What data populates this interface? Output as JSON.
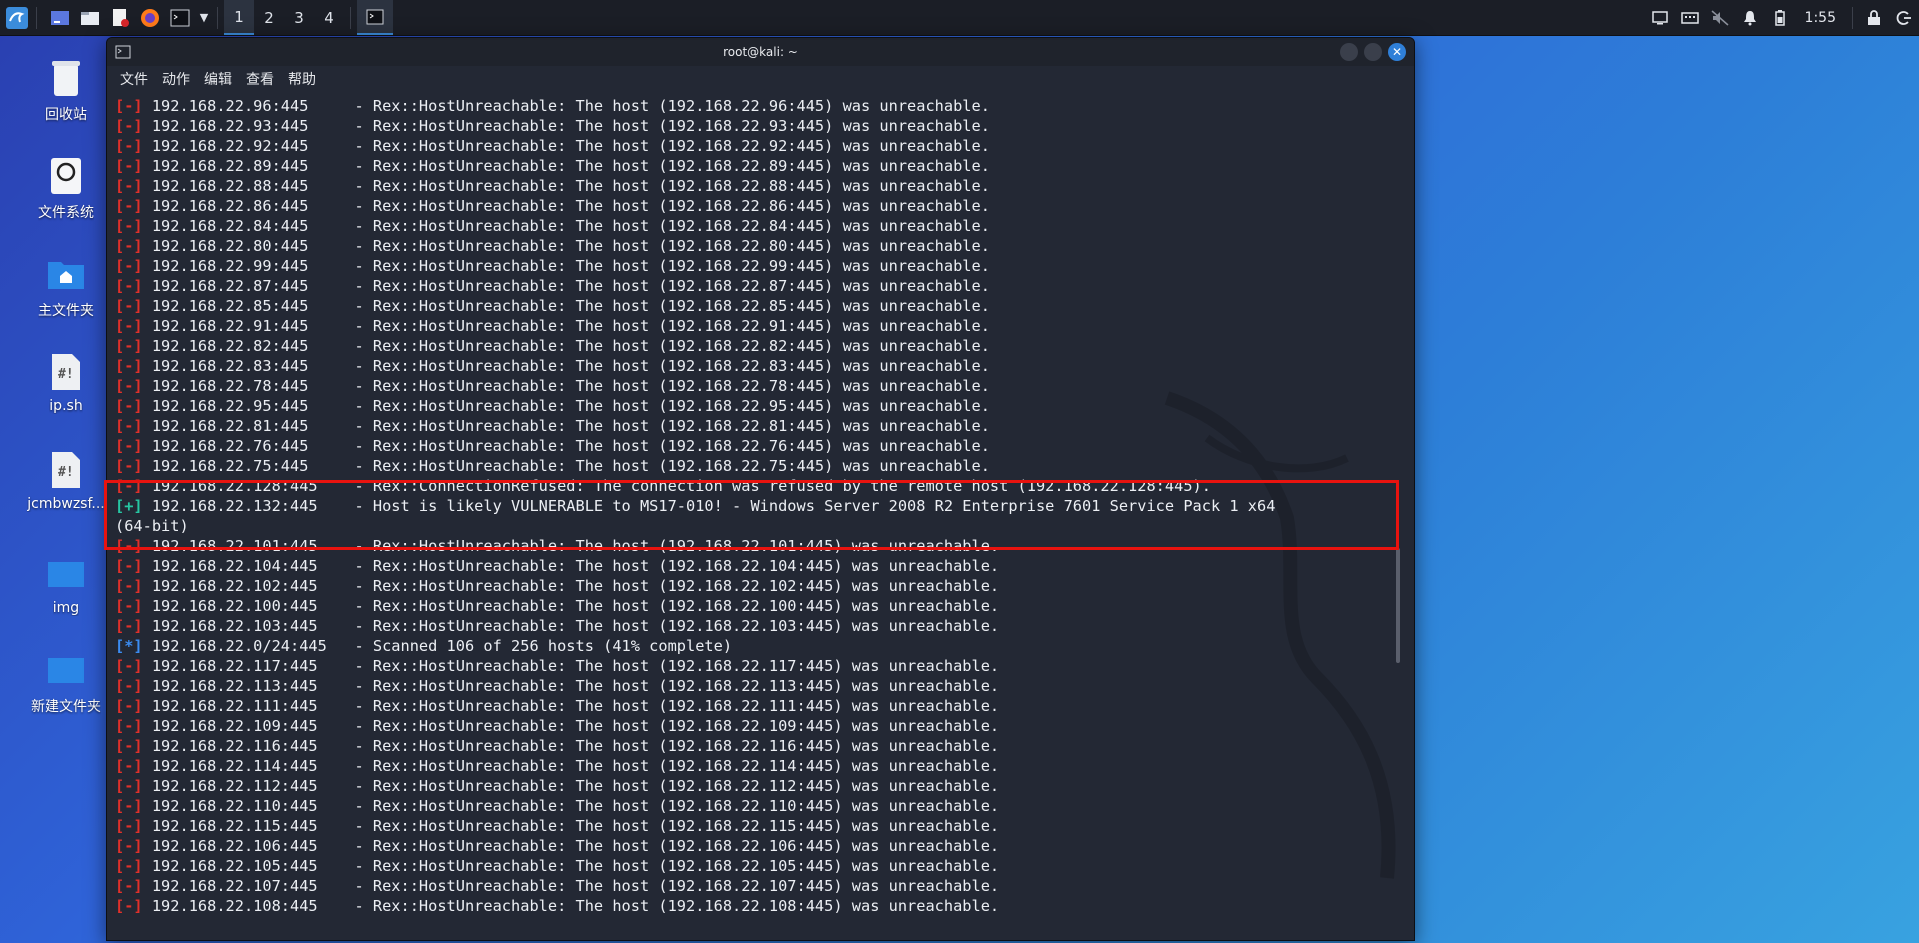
{
  "taskbar": {
    "workspaces": [
      "1",
      "2",
      "3",
      "4"
    ],
    "clock": "1:55"
  },
  "desktop": {
    "icons": [
      {
        "label": "回收站",
        "icon": "trash-icon"
      },
      {
        "label": "文件系统",
        "icon": "drive-icon"
      },
      {
        "label": "主文件夹",
        "icon": "home-folder-icon"
      },
      {
        "label": "ip.sh",
        "icon": "script-icon"
      },
      {
        "label": "jcmbwzsf...",
        "icon": "script-icon"
      },
      {
        "label": "img",
        "icon": "folder-icon"
      },
      {
        "label": "新建文件夹",
        "icon": "folder-icon"
      }
    ]
  },
  "window": {
    "title": "root@kali: ~",
    "menu": [
      "文件",
      "动作",
      "编辑",
      "查看",
      "帮助"
    ]
  },
  "terminal": {
    "lines": [
      {
        "tag": "[-]",
        "kind": "minus",
        "text": " 192.168.22.96:445     - Rex::HostUnreachable: The host (192.168.22.96:445) was unreachable."
      },
      {
        "tag": "[-]",
        "kind": "minus",
        "text": " 192.168.22.93:445     - Rex::HostUnreachable: The host (192.168.22.93:445) was unreachable."
      },
      {
        "tag": "[-]",
        "kind": "minus",
        "text": " 192.168.22.92:445     - Rex::HostUnreachable: The host (192.168.22.92:445) was unreachable."
      },
      {
        "tag": "[-]",
        "kind": "minus",
        "text": " 192.168.22.89:445     - Rex::HostUnreachable: The host (192.168.22.89:445) was unreachable."
      },
      {
        "tag": "[-]",
        "kind": "minus",
        "text": " 192.168.22.88:445     - Rex::HostUnreachable: The host (192.168.22.88:445) was unreachable."
      },
      {
        "tag": "[-]",
        "kind": "minus",
        "text": " 192.168.22.86:445     - Rex::HostUnreachable: The host (192.168.22.86:445) was unreachable."
      },
      {
        "tag": "[-]",
        "kind": "minus",
        "text": " 192.168.22.84:445     - Rex::HostUnreachable: The host (192.168.22.84:445) was unreachable."
      },
      {
        "tag": "[-]",
        "kind": "minus",
        "text": " 192.168.22.80:445     - Rex::HostUnreachable: The host (192.168.22.80:445) was unreachable."
      },
      {
        "tag": "[-]",
        "kind": "minus",
        "text": " 192.168.22.99:445     - Rex::HostUnreachable: The host (192.168.22.99:445) was unreachable."
      },
      {
        "tag": "[-]",
        "kind": "minus",
        "text": " 192.168.22.87:445     - Rex::HostUnreachable: The host (192.168.22.87:445) was unreachable."
      },
      {
        "tag": "[-]",
        "kind": "minus",
        "text": " 192.168.22.85:445     - Rex::HostUnreachable: The host (192.168.22.85:445) was unreachable."
      },
      {
        "tag": "[-]",
        "kind": "minus",
        "text": " 192.168.22.91:445     - Rex::HostUnreachable: The host (192.168.22.91:445) was unreachable."
      },
      {
        "tag": "[-]",
        "kind": "minus",
        "text": " 192.168.22.82:445     - Rex::HostUnreachable: The host (192.168.22.82:445) was unreachable."
      },
      {
        "tag": "[-]",
        "kind": "minus",
        "text": " 192.168.22.83:445     - Rex::HostUnreachable: The host (192.168.22.83:445) was unreachable."
      },
      {
        "tag": "[-]",
        "kind": "minus",
        "text": " 192.168.22.78:445     - Rex::HostUnreachable: The host (192.168.22.78:445) was unreachable."
      },
      {
        "tag": "[-]",
        "kind": "minus",
        "text": " 192.168.22.95:445     - Rex::HostUnreachable: The host (192.168.22.95:445) was unreachable."
      },
      {
        "tag": "[-]",
        "kind": "minus",
        "text": " 192.168.22.81:445     - Rex::HostUnreachable: The host (192.168.22.81:445) was unreachable."
      },
      {
        "tag": "[-]",
        "kind": "minus",
        "text": " 192.168.22.76:445     - Rex::HostUnreachable: The host (192.168.22.76:445) was unreachable."
      },
      {
        "tag": "[-]",
        "kind": "minus",
        "text": " 192.168.22.75:445     - Rex::HostUnreachable: The host (192.168.22.75:445) was unreachable."
      },
      {
        "tag": "[-]",
        "kind": "minus",
        "text": " 192.168.22.128:445    - Rex::ConnectionRefused: The connection was refused by the remote host (192.168.22.128:445)."
      },
      {
        "tag": "[+]",
        "kind": "plus",
        "text": " 192.168.22.132:445    - Host is likely VULNERABLE to MS17-010! - Windows Server 2008 R2 Enterprise 7601 Service Pack 1 x64"
      },
      {
        "tag": "",
        "kind": "plain",
        "text": "(64-bit)"
      },
      {
        "tag": "[-]",
        "kind": "minus",
        "text": " 192.168.22.101:445    - Rex::HostUnreachable: The host (192.168.22.101:445) was unreachable."
      },
      {
        "tag": "[-]",
        "kind": "minus",
        "text": " 192.168.22.104:445    - Rex::HostUnreachable: The host (192.168.22.104:445) was unreachable."
      },
      {
        "tag": "[-]",
        "kind": "minus",
        "text": " 192.168.22.102:445    - Rex::HostUnreachable: The host (192.168.22.102:445) was unreachable."
      },
      {
        "tag": "[-]",
        "kind": "minus",
        "text": " 192.168.22.100:445    - Rex::HostUnreachable: The host (192.168.22.100:445) was unreachable."
      },
      {
        "tag": "[-]",
        "kind": "minus",
        "text": " 192.168.22.103:445    - Rex::HostUnreachable: The host (192.168.22.103:445) was unreachable."
      },
      {
        "tag": "[*]",
        "kind": "star",
        "text": " 192.168.22.0/24:445   - Scanned 106 of 256 hosts (41% complete)"
      },
      {
        "tag": "[-]",
        "kind": "minus",
        "text": " 192.168.22.117:445    - Rex::HostUnreachable: The host (192.168.22.117:445) was unreachable."
      },
      {
        "tag": "[-]",
        "kind": "minus",
        "text": " 192.168.22.113:445    - Rex::HostUnreachable: The host (192.168.22.113:445) was unreachable."
      },
      {
        "tag": "[-]",
        "kind": "minus",
        "text": " 192.168.22.111:445    - Rex::HostUnreachable: The host (192.168.22.111:445) was unreachable."
      },
      {
        "tag": "[-]",
        "kind": "minus",
        "text": " 192.168.22.109:445    - Rex::HostUnreachable: The host (192.168.22.109:445) was unreachable."
      },
      {
        "tag": "[-]",
        "kind": "minus",
        "text": " 192.168.22.116:445    - Rex::HostUnreachable: The host (192.168.22.116:445) was unreachable."
      },
      {
        "tag": "[-]",
        "kind": "minus",
        "text": " 192.168.22.114:445    - Rex::HostUnreachable: The host (192.168.22.114:445) was unreachable."
      },
      {
        "tag": "[-]",
        "kind": "minus",
        "text": " 192.168.22.112:445    - Rex::HostUnreachable: The host (192.168.22.112:445) was unreachable."
      },
      {
        "tag": "[-]",
        "kind": "minus",
        "text": " 192.168.22.110:445    - Rex::HostUnreachable: The host (192.168.22.110:445) was unreachable."
      },
      {
        "tag": "[-]",
        "kind": "minus",
        "text": " 192.168.22.115:445    - Rex::HostUnreachable: The host (192.168.22.115:445) was unreachable."
      },
      {
        "tag": "[-]",
        "kind": "minus",
        "text": " 192.168.22.106:445    - Rex::HostUnreachable: The host (192.168.22.106:445) was unreachable."
      },
      {
        "tag": "[-]",
        "kind": "minus",
        "text": " 192.168.22.105:445    - Rex::HostUnreachable: The host (192.168.22.105:445) was unreachable."
      },
      {
        "tag": "[-]",
        "kind": "minus",
        "text": " 192.168.22.107:445    - Rex::HostUnreachable: The host (192.168.22.107:445) was unreachable."
      },
      {
        "tag": "[-]",
        "kind": "minus",
        "text": " 192.168.22.108:445    - Rex::HostUnreachable: The host (192.168.22.108:445) was unreachable."
      }
    ]
  }
}
